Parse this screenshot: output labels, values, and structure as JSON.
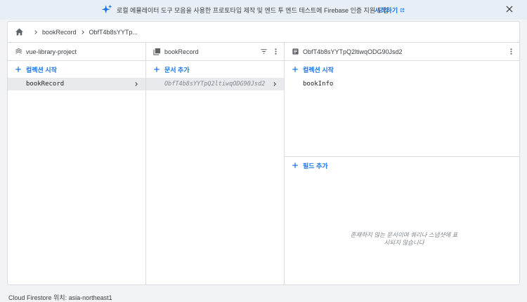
{
  "banner": {
    "icon": "sparkle-icon",
    "text": "로컬 에뮬레이터 도구 모음을 사용한 프로토타입 제작 및 엔드 투 엔드 테스트에 Firebase 인증 지원 도입",
    "cta": "시작하기",
    "cta_icon": "open-in-new-icon",
    "close_icon": "close-icon",
    "accent": "#1a73e8"
  },
  "breadcrumb": {
    "home_icon": "home-icon",
    "items": [
      "bookRecord",
      "ObfT4b8sYYTp..."
    ]
  },
  "columns": {
    "root": {
      "title": "vue-library-project",
      "add_label": "컬렉션 시작",
      "items": [
        "bookRecord"
      ]
    },
    "collection": {
      "title": "bookRecord",
      "add_label": "문서 추가",
      "items": [
        "ObfT4b8sYYTpQ2ltiwqODG90Jsd2"
      ]
    },
    "document": {
      "title": "ObfT4b8sYYTpQ2ltiwqODG90Jsd2",
      "add_collection_label": "컬렉션 시작",
      "subcollections": [
        "bookInfo"
      ],
      "add_field_label": "필드 추가",
      "empty_message": "존재하지 않는 문서이며 쿼리나 스냅샷에 표시되지 않습니다"
    }
  },
  "footer": {
    "text": "Cloud Firestore 위치: asia-northeast1"
  }
}
